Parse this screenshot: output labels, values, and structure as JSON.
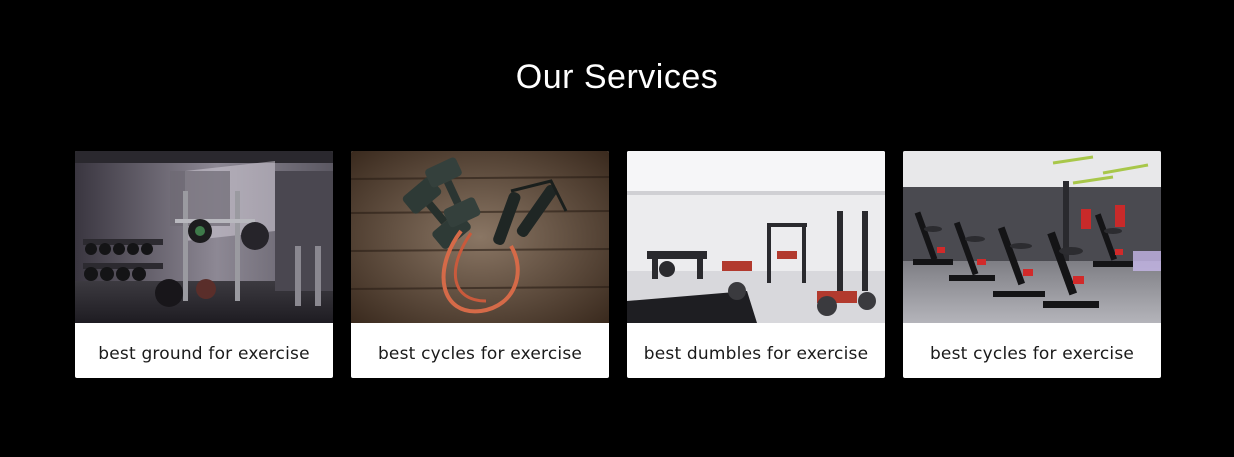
{
  "section": {
    "title": "Our Services"
  },
  "cards": [
    {
      "label": "best ground for exercise",
      "image": "gym-weight-room-photo"
    },
    {
      "label": "best cycles for exercise",
      "image": "dumbbells-and-resistance-band-photo"
    },
    {
      "label": "best dumbles for exercise",
      "image": "bright-gym-floor-photo"
    },
    {
      "label": "best cycles for exercise",
      "image": "spin-bikes-studio-photo"
    }
  ],
  "colors": {
    "page_background": "#000000",
    "title_text": "#ffffff",
    "card_background": "#ffffff",
    "card_text": "#1a1a1a"
  }
}
